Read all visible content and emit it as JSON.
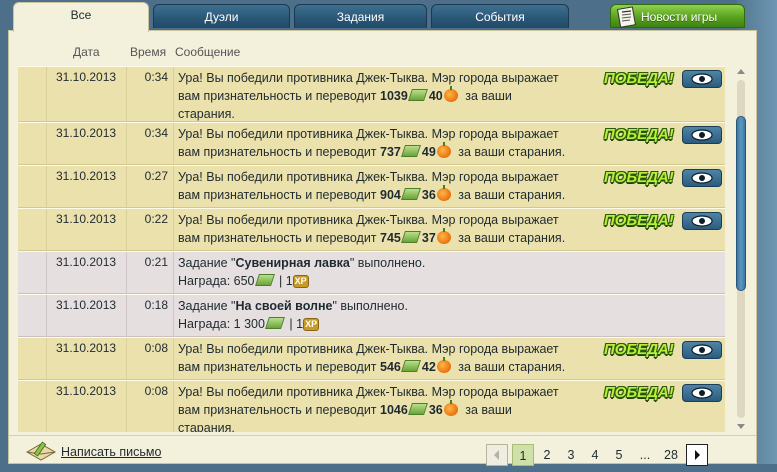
{
  "tabs": [
    {
      "label": "Все"
    },
    {
      "label": "Дуэли"
    },
    {
      "label": "Задания"
    },
    {
      "label": "События"
    },
    {
      "label": "Новости игры"
    }
  ],
  "columns": {
    "date": "Дата",
    "time": "Время",
    "message": "Сообщение"
  },
  "victory_label": "ПОБЕДА!",
  "rows": [
    {
      "date": "31.10.2013",
      "time": "0:34",
      "type": "win",
      "line1": "Ура! Вы победили противника Джек-Тыква. Мэр города выражает",
      "line2_pre": "вам признательность и переводит ",
      "money": "1039",
      "pumpkins": "40",
      "line2_post": " за ваши",
      "line3": "старания."
    },
    {
      "date": "31.10.2013",
      "time": "0:34",
      "type": "win",
      "line1": "Ура! Вы победили противника Джек-Тыква. Мэр города выражает",
      "line2_pre": "вам признательность и переводит ",
      "money": "737",
      "pumpkins": "49",
      "line2_post": " за ваши старания."
    },
    {
      "date": "31.10.2013",
      "time": "0:27",
      "type": "win",
      "line1": "Ура! Вы победили противника Джек-Тыква. Мэр города выражает",
      "line2_pre": "вам признательность и переводит ",
      "money": "904",
      "pumpkins": "36",
      "line2_post": " за ваши старания."
    },
    {
      "date": "31.10.2013",
      "time": "0:22",
      "type": "win",
      "line1": "Ура! Вы победили противника Джек-Тыква. Мэр города выражает",
      "line2_pre": "вам признательность и переводит ",
      "money": "745",
      "pumpkins": "37",
      "line2_post": " за ваши старания."
    },
    {
      "date": "31.10.2013",
      "time": "0:21",
      "type": "task",
      "pre": "Задание \"",
      "name": "Сувенирная лавка",
      "post": "\" выполнено.",
      "reward_label": "Награда: ",
      "reward_money": "650",
      "reward_sep": " | ",
      "reward_xp": "1",
      "xp_label": "XP"
    },
    {
      "date": "31.10.2013",
      "time": "0:18",
      "type": "task",
      "pre": "Задание \"",
      "name": "На своей волне",
      "post": "\" выполнено.",
      "reward_label": "Награда: ",
      "reward_money": "1 300",
      "reward_sep": " | ",
      "reward_xp": "1",
      "xp_label": "XP"
    },
    {
      "date": "31.10.2013",
      "time": "0:08",
      "type": "win",
      "line1": "Ура! Вы победили противника Джек-Тыква. Мэр города выражает",
      "line2_pre": "вам признательность и переводит ",
      "money": "546",
      "pumpkins": "42",
      "line2_post": " за ваши старания."
    },
    {
      "date": "31.10.2013",
      "time": "0:08",
      "type": "win",
      "line1": "Ура! Вы победили противника Джек-Тыква. Мэр города выражает",
      "line2_pre": "вам признательность и переводит ",
      "money": "1046",
      "pumpkins": "36",
      "line2_post": " за ваши",
      "line3": "старания."
    }
  ],
  "footer": {
    "compose_label": "Написать письмо"
  },
  "pager": {
    "pages": [
      "1",
      "2",
      "3",
      "4",
      "5",
      "...",
      "28"
    ],
    "current": "1"
  },
  "icons": {
    "tab_news": "newspaper-icon",
    "view": "eye-icon",
    "compose": "envelope-pencil-icon",
    "money": "banknote-icon",
    "pumpkin": "pumpkin-icon",
    "xp": "xp-badge-icon"
  },
  "colors": {
    "win_row": "#ebe1ac",
    "task_row": "#e5dfe0",
    "tab_blue": "#2a5675",
    "news_green": "#5aa21f",
    "panel": "#f3f0dc"
  }
}
